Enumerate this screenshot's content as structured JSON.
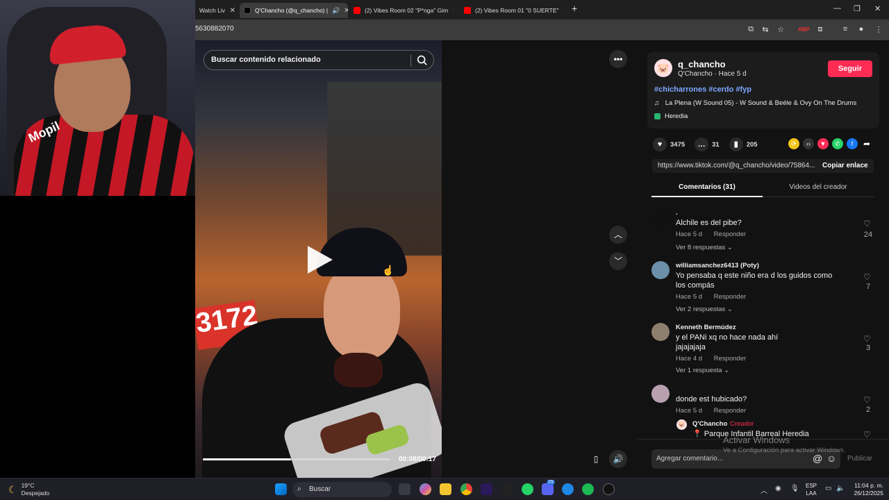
{
  "browser": {
    "tabs": [
      {
        "label": "Watch Liv",
        "favicon_color": "#2b2b2b"
      },
      {
        "label": "Q'Chancho (@q_chancho) |",
        "favicon_color": "#000000",
        "active": true
      },
      {
        "label": "(2) Vibes Room 02 \"P*nga\" Gim",
        "favicon_color": "#ff0000"
      },
      {
        "label": "(2) Vibes Room 01 \"0 SUERTE\"",
        "favicon_color": "#ff0000"
      }
    ],
    "url_fragment": "5630882070"
  },
  "video": {
    "search_placeholder": "Buscar contenido relacionado",
    "sign_text": "3172",
    "progress_fraction": 0.47,
    "time": "00:08/00:17"
  },
  "creator": {
    "username": "q_chancho",
    "subtitle": "Q'Chancho · Hace 5 d",
    "follow_label": "Seguir",
    "hashtags": "#chicharrones #cerdo #fyp",
    "music": "La Plena (W Sound 05) - W Sound & Beéle & Ovy On The Drums",
    "location": "Heredia"
  },
  "stats": {
    "likes": "3475",
    "comments": "31",
    "saves": "205"
  },
  "link": {
    "url": "https://www.tiktok.com/@q_chancho/video/75864...",
    "copy_label": "Copiar enlace"
  },
  "panel_tabs": {
    "comments": "Comentarios (31)",
    "creator_videos": "Videos del creador"
  },
  "comments": [
    {
      "user": ".",
      "text": "Alchile es del pibe?",
      "time": "Hace 5 d",
      "reply": "Responder",
      "replies": "Ver 8 respuestas",
      "likes": "24",
      "avatar_color": "#111111"
    },
    {
      "user": "williamsanchez6413 (Poty)",
      "text": "Yo pensaba q este niño era d los guidos como los compás",
      "time": "Hace 5 d",
      "reply": "Responder",
      "replies": "Ver 2 respuestas",
      "likes": "7",
      "avatar_color": "#6b8fa8"
    },
    {
      "user": "Kenneth Bermúdez",
      "text": "y el PANi xq no hace nada ahí jajajajaja",
      "time": "Hace 4 d",
      "reply": "Responder",
      "replies": "Ver 1 respuesta",
      "likes": "3",
      "avatar_color": "#8c7f6e"
    },
    {
      "user": "",
      "text": "donde est hubicado?",
      "time": "Hace 5 d",
      "reply": "Responder",
      "replies": "",
      "likes": "2",
      "avatar_color": "#b9a0b0"
    }
  ],
  "creator_reply": {
    "user": "Q'Chancho",
    "badge": "Creador",
    "text": "📍 Parque Infantil Barreal Heredia"
  },
  "add_comment": {
    "placeholder": "Agregar comentario...",
    "publish": "Publicar"
  },
  "watermark": {
    "line1": "Activar Windows",
    "line2": "Ve a Configuración para activar Windows."
  },
  "webcam": {
    "shirt_text": "Mopil"
  },
  "taskbar": {
    "temp": "19°C",
    "weather": "Despejado",
    "search": "Buscar",
    "lang1": "ESP",
    "lang2": "LAA",
    "time": "11:04 p. m.",
    "date": "26/12/2025",
    "discord_badge": "29"
  },
  "colors": {
    "accent": "#fe2c55",
    "hashtag": "#7ea7ff",
    "creator_badge": "#fe2c55"
  }
}
